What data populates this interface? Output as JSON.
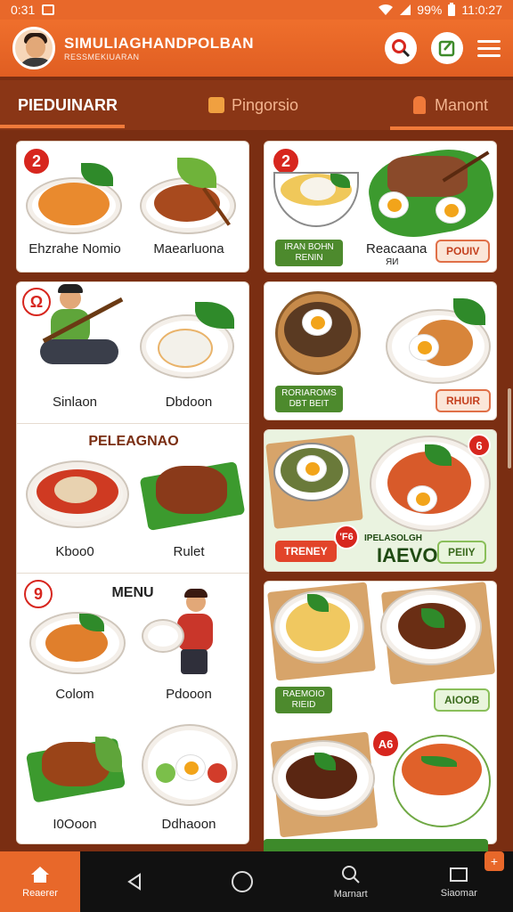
{
  "status_bar": {
    "time_left": "0:31",
    "battery": "99%",
    "time_right": "11:0:27"
  },
  "app": {
    "title": "SIMULIAGHANDPOLBAN",
    "subtitle": "RESSMEKIUARAN"
  },
  "tabs": [
    {
      "label": "PIEDUINARR"
    },
    {
      "label": "Pingorsio"
    },
    {
      "label": "Manont"
    }
  ],
  "left_column": {
    "card1": {
      "badge": "2",
      "items": [
        "Ehzrahe Nomio",
        "Maearluona"
      ]
    },
    "card2": {
      "badge": "Ω",
      "items": [
        "Sinlaon",
        "Dbdoon"
      ],
      "section2_title": "PELEAGNAO",
      "items2": [
        "Kboo0",
        "Rulet"
      ],
      "badge3": "9",
      "section3_title": "MENU",
      "items3": [
        "Colom",
        "Pdooon"
      ],
      "items4": [
        "I0Ooon",
        "Ddhaoon"
      ]
    }
  },
  "right_column": {
    "card1": {
      "badge": "2",
      "green_pill": "IRAN BOHN RENIN",
      "label": "Reacaana",
      "label_sub": "ЯИ",
      "button": "POUIV"
    },
    "card2": {
      "green_pill": "RORIAROMS DBT BEIT",
      "button": "RHUIR"
    },
    "card3": {
      "badge": "6",
      "red_button": "TRENEY",
      "mini_badge": "'F6",
      "caption": "IPELASOLGH",
      "big_label": "IAEVO",
      "button": "PEIIY"
    },
    "card4": {
      "green_pill": "RAEMOIO RIEID",
      "button": "AIOOB",
      "badge": "A6"
    }
  },
  "bottom_nav": [
    {
      "label": "Reaerer"
    },
    {
      "label": "Marnart"
    },
    {
      "label": "Siaomar"
    }
  ],
  "colors": {
    "primary": "#e8682a",
    "dark": "#7a2e12",
    "green": "#4d8a2d",
    "red": "#d7261e"
  }
}
